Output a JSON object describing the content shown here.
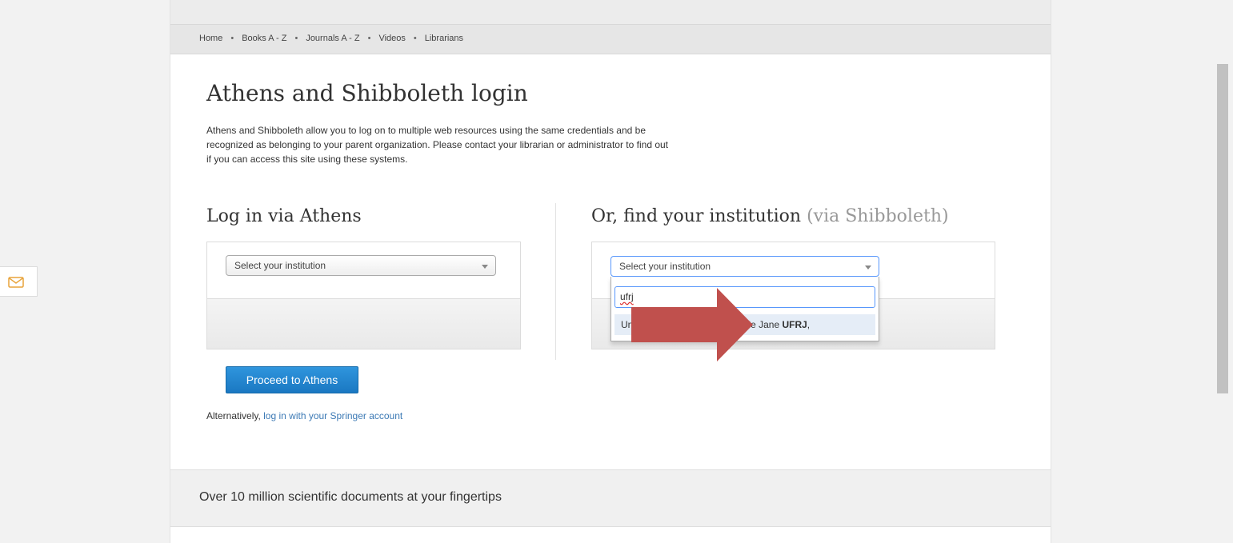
{
  "nav": {
    "items": [
      "Home",
      "Books A - Z",
      "Journals A - Z",
      "Videos",
      "Librarians"
    ],
    "separator": "•"
  },
  "page": {
    "title": "Athens and Shibboleth login",
    "intro_lines": [
      "Athens and Shibboleth allow you to log on to multiple web resources using the same credentials and be",
      "recognized as belonging to your parent organization. Please contact your librarian or administrator to find out",
      "if you can access this site using these systems."
    ]
  },
  "athens": {
    "heading": "Log in via Athens",
    "select_value": "Select your institution",
    "button_label": "Proceed to Athens"
  },
  "shibboleth": {
    "heading": "Or, find your institution",
    "heading_muted": "(via Shibboleth)",
    "select_value": "Select your institution",
    "search_value": "ufrj",
    "result_prefix": "Universidade Federal do Rio de Jane ",
    "result_match": "UFRJ",
    "result_suffix": ","
  },
  "alternative": {
    "prefix": "Alternatively, ",
    "link": "log in with your Springer account"
  },
  "footer": {
    "tagline": "Over 10 million scientific documents at your fingertips"
  },
  "colors": {
    "annotation_arrow": "#c0504d",
    "primary_button": "#1f82cd",
    "link": "#3d7ab5",
    "mail_icon": "#e8a33a"
  },
  "icons": {
    "feedback": "mail-icon",
    "select_arrow": "chevron-down-icon"
  }
}
